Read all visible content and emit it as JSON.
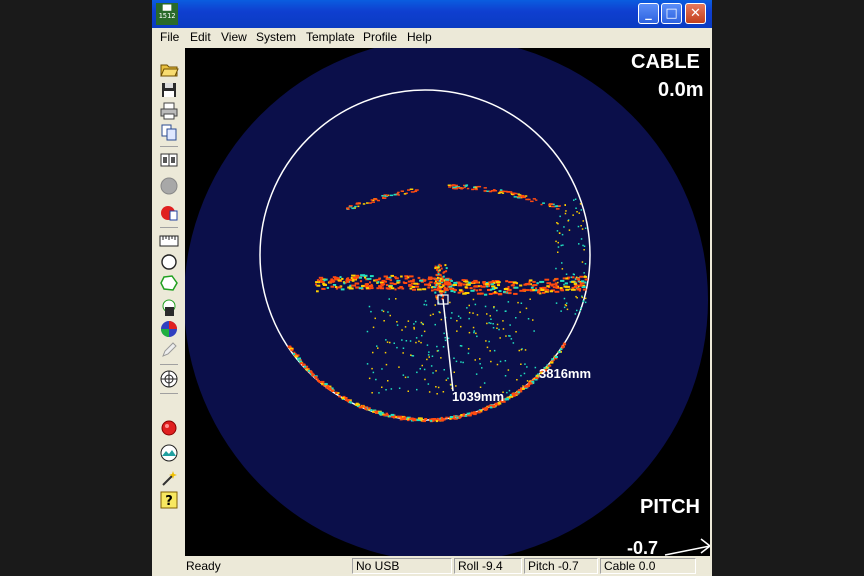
{
  "window": {
    "icon_text": "1512",
    "controls": {
      "minimize": "minimize-icon",
      "maximize": "maximize-icon",
      "close": "close-icon"
    }
  },
  "menu": [
    "File",
    "Edit",
    "View",
    "System",
    "Template",
    "Profile",
    "Help"
  ],
  "toolbar": [
    "open-folder-icon",
    "save-icon",
    "print-icon",
    "copy-icon",
    "book-icon",
    "record-gray-icon",
    "record-red-icon",
    "ruler-icon",
    "circle-icon",
    "polygon-icon",
    "save-profile-icon",
    "color-palette-icon",
    "pencil-icon",
    "compass-rose-icon",
    "red-dot-icon",
    "mountain-icon",
    "magic-wand-icon",
    "help-icon"
  ],
  "sonar": {
    "cable_label": "CABLE",
    "cable_value": "0.0m",
    "pitch_label": "PITCH",
    "pitch_value": "-0.7",
    "measure_diameter": "3816mm",
    "measure_distance": "1039mm",
    "colors": {
      "background": "#000000",
      "disc": "#0b0f4a",
      "ring": "#ffffff",
      "echo_hot": "#ff4a10",
      "echo_mid": "#ffd000",
      "echo_cold": "#20e0c0"
    }
  },
  "status": {
    "ready": "Ready",
    "usb": "No USB",
    "roll": "Roll -9.4",
    "pitch": "Pitch -0.7",
    "cable": "Cable 0.0"
  }
}
